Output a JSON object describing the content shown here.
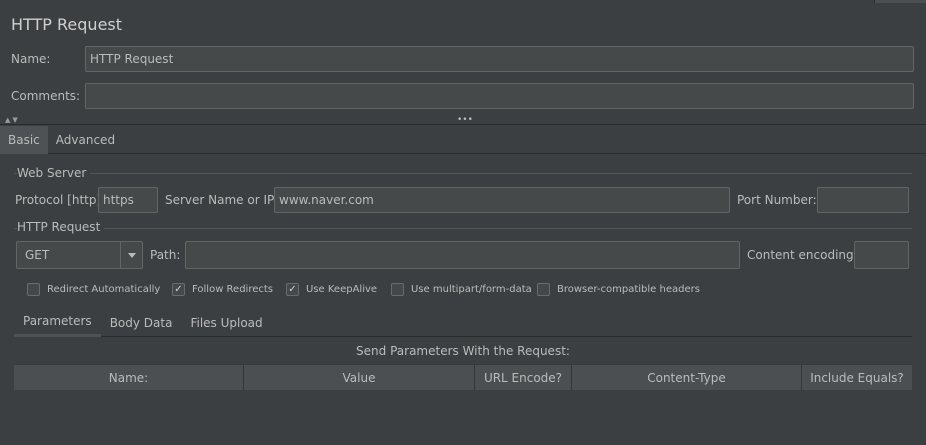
{
  "header": {
    "title": "HTTP Request",
    "name_label": "Name:",
    "name_value": "HTTP Request",
    "comments_label": "Comments:",
    "comments_value": ""
  },
  "main_tabs": [
    {
      "label": "Basic",
      "selected": true
    },
    {
      "label": "Advanced",
      "selected": false
    }
  ],
  "web_server": {
    "section_title": "Web Server",
    "protocol_label": "Protocol [http]:",
    "protocol_value": "https",
    "server_label": "Server Name or IP:",
    "server_value": "www.naver.com",
    "port_label": "Port Number:",
    "port_value": ""
  },
  "http_request": {
    "section_title": "HTTP Request",
    "method": "GET",
    "path_label": "Path:",
    "path_value": "",
    "encoding_label": "Content encoding:",
    "encoding_value": ""
  },
  "options": [
    {
      "label": "Redirect Automatically",
      "checked": false
    },
    {
      "label": "Follow Redirects",
      "checked": true
    },
    {
      "label": "Use KeepAlive",
      "checked": true
    },
    {
      "label": "Use multipart/form-data",
      "checked": false
    },
    {
      "label": "Browser-compatible headers",
      "checked": false
    }
  ],
  "sub_tabs": [
    {
      "label": "Parameters",
      "selected": true
    },
    {
      "label": "Body Data",
      "selected": false
    },
    {
      "label": "Files Upload",
      "selected": false
    }
  ],
  "params": {
    "caption": "Send Parameters With the Request:",
    "columns": [
      "Name:",
      "Value",
      "URL Encode?",
      "Content-Type",
      "Include Equals?"
    ]
  },
  "icons": {
    "collapse": "collapse-arrows-icon",
    "splitter": "splitter-dots-icon",
    "combo": "chevron-down-icon",
    "check": "check-icon"
  }
}
